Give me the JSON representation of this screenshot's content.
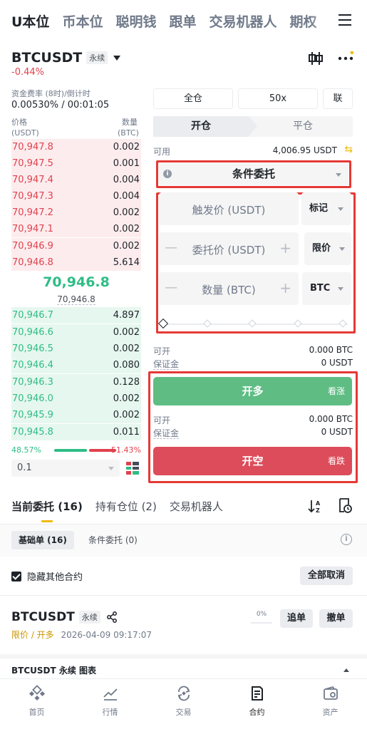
{
  "top_tabs": [
    "U本位",
    "币本位",
    "聪明钱",
    "跟单",
    "交易机器人",
    "期权"
  ],
  "symbol": {
    "name": "BTCUSDT",
    "tag": "永续",
    "change": "-0.44%"
  },
  "funding": {
    "label": "资金费率 (8时)/倒计时",
    "value": "0.00530% / 00:01:05"
  },
  "orderbook": {
    "price_header": "价格",
    "price_unit": "(USDT)",
    "qty_header": "数量",
    "qty_unit": "(BTC)",
    "asks": [
      {
        "price": "70,947.8",
        "qty": "0.002"
      },
      {
        "price": "70,947.5",
        "qty": "0.001"
      },
      {
        "price": "70,947.4",
        "qty": "0.004"
      },
      {
        "price": "70,947.3",
        "qty": "0.004"
      },
      {
        "price": "70,947.2",
        "qty": "0.002"
      },
      {
        "price": "70,947.1",
        "qty": "0.002"
      },
      {
        "price": "70,946.9",
        "qty": "0.002"
      },
      {
        "price": "70,946.8",
        "qty": "5.614"
      }
    ],
    "last_price": "70,946.8",
    "mark_price": "70,946.8",
    "bids": [
      {
        "price": "70,946.7",
        "qty": "4.897"
      },
      {
        "price": "70,946.6",
        "qty": "0.002"
      },
      {
        "price": "70,946.5",
        "qty": "0.002"
      },
      {
        "price": "70,946.4",
        "qty": "0.080"
      },
      {
        "price": "70,946.3",
        "qty": "0.128"
      },
      {
        "price": "70,946.0",
        "qty": "0.002"
      },
      {
        "price": "70,945.9",
        "qty": "0.002"
      },
      {
        "price": "70,945.8",
        "qty": "0.011"
      }
    ],
    "buy_ratio": "48.57%",
    "sell_ratio": "51.43%",
    "depth_step": "0.1"
  },
  "trade": {
    "margin_mode": "全仓",
    "leverage": "50x",
    "more": "联",
    "open_tab": "开仓",
    "close_tab": "平仓",
    "available_label": "可用",
    "available_value": "4,006.95 USDT",
    "order_type": "条件委托",
    "trigger_placeholder": "触发价 (USDT)",
    "trigger_unit": "标记",
    "price_placeholder": "委托价 (USDT)",
    "price_type": "限价",
    "qty_placeholder": "数量 (BTC)",
    "qty_unit": "BTC",
    "can_open_label": "可开",
    "can_open_long": "0.000 BTC",
    "margin_label": "保证金",
    "margin_long": "0 USDT",
    "long_label": "开多",
    "long_sub": "看涨",
    "can_open_short": "0.000 BTC",
    "margin_short": "0 USDT",
    "short_label": "开空",
    "short_sub": "看跌"
  },
  "orders": {
    "tabs": [
      "当前委托 (16)",
      "持有仓位 (2)",
      "交易机器人"
    ],
    "sub_basic": "基础单 (16)",
    "sub_conditional": "条件委托 (0)",
    "hide_others": "隐藏其他合约",
    "cancel_all": "全部取消",
    "item": {
      "symbol": "BTCUSDT",
      "tag": "永续",
      "type": "限价 / 开多",
      "time": "2026-04-09 09:17:07",
      "progress": "0%",
      "chase": "追单",
      "cancel": "撤单"
    },
    "chart_label": "BTCUSDT 永续 图表"
  },
  "nav": [
    "首页",
    "行情",
    "交易",
    "合约",
    "资产"
  ],
  "colors": {
    "up": "#2ebd85",
    "down": "#e0424d",
    "accent": "#f0b90b",
    "highlight_box": "#e53935"
  }
}
